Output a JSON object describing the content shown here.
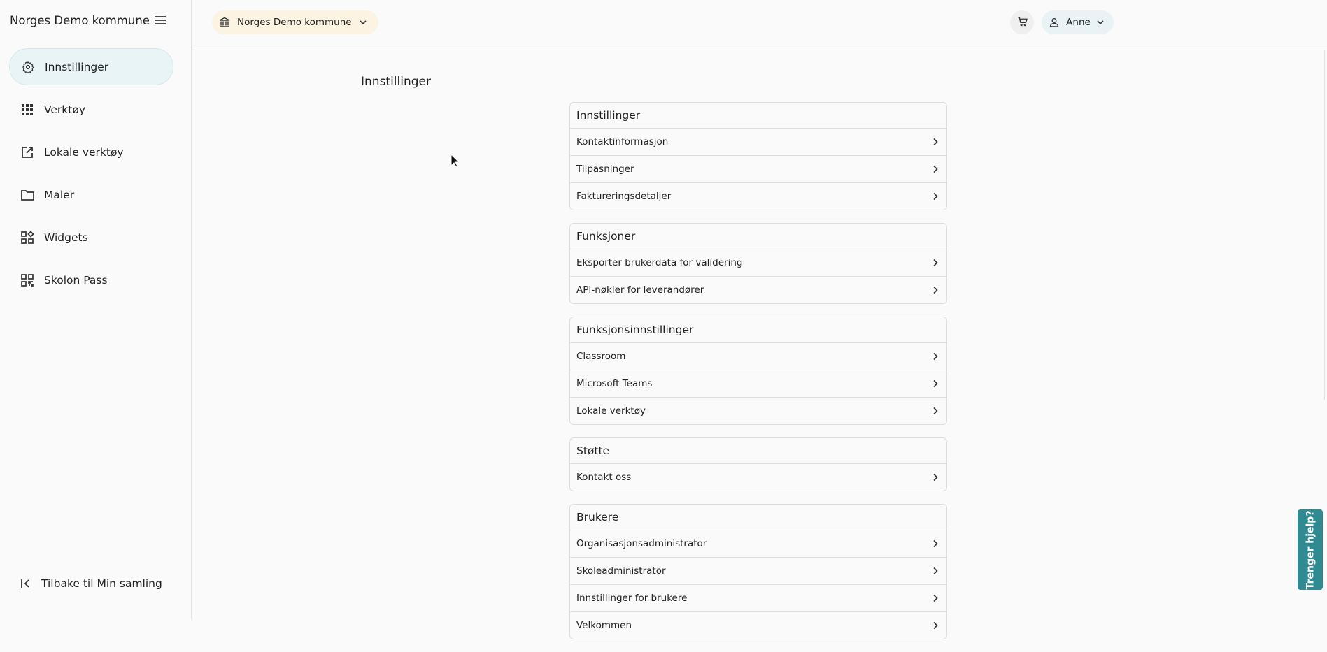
{
  "sidebar": {
    "brand": "Norges Demo kommune",
    "items": [
      {
        "label": "Innstillinger",
        "icon": "gear-icon",
        "active": true
      },
      {
        "label": "Verktøy",
        "icon": "grid-icon"
      },
      {
        "label": "Lokale verktøy",
        "icon": "external-link-icon"
      },
      {
        "label": "Maler",
        "icon": "folder-icon"
      },
      {
        "label": "Widgets",
        "icon": "widgets-icon"
      },
      {
        "label": "Skolon Pass",
        "icon": "qr-code-icon"
      }
    ],
    "back_label": "Tilbake til Min samling"
  },
  "topbar": {
    "org_label": "Norges Demo kommune",
    "user_label": "Anne"
  },
  "main": {
    "title": "Innstillinger",
    "sections": [
      {
        "title": "Innstillinger",
        "items": [
          "Kontaktinformasjon",
          "Tilpasninger",
          "Faktureringsdetaljer"
        ]
      },
      {
        "title": "Funksjoner",
        "items": [
          "Eksporter brukerdata for validering",
          "API-nøkler for leverandører"
        ]
      },
      {
        "title": "Funksjonsinnstillinger",
        "items": [
          "Classroom",
          "Microsoft Teams",
          "Lokale verktøy"
        ]
      },
      {
        "title": "Støtte",
        "items": [
          "Kontakt oss"
        ]
      },
      {
        "title": "Brukere",
        "items": [
          "Organisasjonsadministrator",
          "Skoleadministrator",
          "Innstillinger for brukere",
          "Velkommen"
        ]
      }
    ]
  },
  "help_tab": "Trenger hjelp?",
  "colors": {
    "accent": "#2f8a92",
    "active_nav_bg": "#e8f4f6",
    "org_chip_bg": "#fdf3e3"
  }
}
